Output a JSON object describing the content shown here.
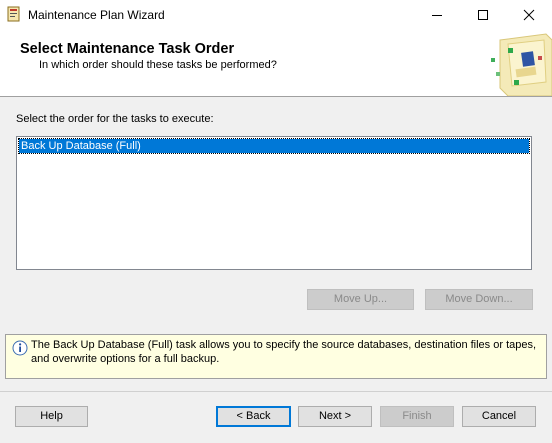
{
  "window": {
    "title": "Maintenance Plan Wizard",
    "app_icon": "wizard-icon",
    "controls": [
      "minimize-icon",
      "maximize-icon",
      "close-icon"
    ]
  },
  "header": {
    "title": "Select Maintenance Task Order",
    "subtitle": "In which order should these tasks be performed?",
    "graphic": "wizard-tasks-graphic"
  },
  "main": {
    "label": "Select the order for the tasks to execute:",
    "tasks": [
      {
        "label": "Back Up Database (Full)",
        "selected": true
      }
    ],
    "move_up_label": "Move Up...",
    "move_down_label": "Move Down..."
  },
  "info": {
    "icon": "info-icon",
    "text": "The Back Up Database (Full) task allows you to specify the source databases, destination files or tapes, and overwrite options for a full backup."
  },
  "footer": {
    "help_label": "Help",
    "back_label": "< Back",
    "next_label": "Next >",
    "finish_label": "Finish",
    "cancel_label": "Cancel"
  },
  "colors": {
    "selection": "#0078d7",
    "info_background": "#ffffe1",
    "dialog_background": "#f0f0f0"
  }
}
